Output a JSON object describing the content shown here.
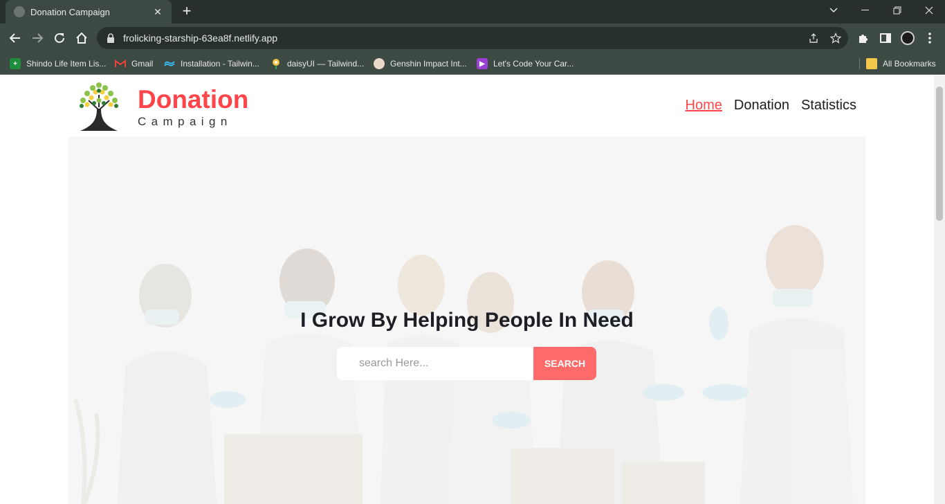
{
  "browser": {
    "tab_title": "Donation Campaign",
    "url": "frolicking-starship-63ea8f.netlify.app",
    "bookmarks": [
      {
        "label": "Shindo Life Item Lis...",
        "icon": "plus-square-icon",
        "color": "#1e8e3e"
      },
      {
        "label": "Gmail",
        "icon": "gmail-icon",
        "color": "#ea4335"
      },
      {
        "label": "Installation - Tailwin...",
        "icon": "tailwind-icon",
        "color": "#38bdf8"
      },
      {
        "label": "daisyUI — Tailwind...",
        "icon": "daisyui-icon",
        "color": "#f5c542"
      },
      {
        "label": "Genshin Impact Int...",
        "icon": "genshin-icon",
        "color": "#e9d9c8"
      },
      {
        "label": "Let's Code Your Car...",
        "icon": "play-icon",
        "color": "#9b3fd6"
      }
    ],
    "all_bookmarks": "All Bookmarks"
  },
  "site": {
    "logo_title": "Donation",
    "logo_subtitle": "Campaign",
    "nav": [
      "Home",
      "Donation",
      "Statistics"
    ]
  },
  "hero": {
    "title": "I Grow By Helping People In Need",
    "search_placeholder": "search Here...",
    "search_button": "SEARCH"
  },
  "colors": {
    "accent": "#ff444a",
    "button": "#ff6b6b",
    "chrome_dark": "#28302c",
    "chrome_mid": "#3d4a44"
  }
}
